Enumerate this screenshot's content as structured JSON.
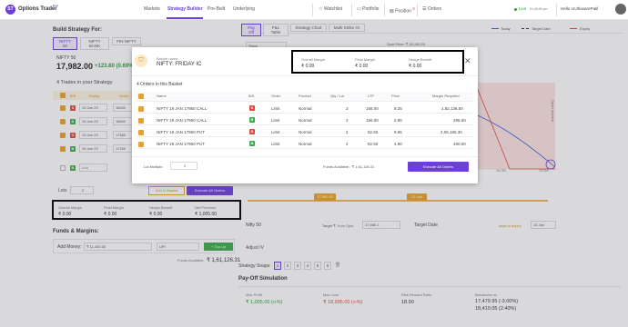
{
  "header": {
    "logo_letter": "ST",
    "brand": "Options Trader",
    "beta": "Beta",
    "nav": [
      "Markets",
      "Strategy Builder",
      "Pre-Built",
      "Underlying"
    ],
    "top_items": [
      "Watchlist",
      "Portfolio",
      "Position",
      "Orders"
    ],
    "position_badge": "8",
    "live_status": "Live",
    "live_time": "01:46:06 pm",
    "greeting": "Hello nnJhavarePatil"
  },
  "left": {
    "title": "Build Strategy For:",
    "instruments": [
      "NIFTY 50",
      "NIFTY BANK",
      "FIN NIFTY"
    ],
    "instrument_name": "NIFTY 50",
    "price": "17,982.00",
    "change": "+123.80 (0.69%)",
    "trades_title": "4 Trades in your Strategy",
    "col_bs": "B/S",
    "col_expiry": "Expiry",
    "col_order": "Order",
    "rows": [
      {
        "bs": "S",
        "expiry": "19 Jan 23",
        "strike": "18400"
      },
      {
        "bs": "B",
        "expiry": "19 Jan 23",
        "strike": "18600"
      },
      {
        "bs": "S",
        "expiry": "19 Jan 23",
        "strike": "17550"
      },
      {
        "bs": "B",
        "expiry": "19 Jan 23",
        "strike": "17250"
      }
    ],
    "add_bs": "B",
    "add_label": "Add",
    "lots_label": "Lots",
    "lots_value": "2",
    "add_to_basket": "Add to Basket",
    "execute_all": "Execute All Orders",
    "summary": [
      {
        "label": "Overall Margin",
        "value": "₹ 0.00"
      },
      {
        "label": "Final Margin",
        "value": "₹ 0.00"
      },
      {
        "label": "Hedge Benefit",
        "value": "₹ 0.00"
      },
      {
        "label": "Net Premium",
        "value": "₹ 1,005.00"
      }
    ],
    "funds_title": "Funds & Margins:",
    "add_money_label": "Add Money:",
    "add_money_value": "₹ 11,400.00",
    "upi": "UPI",
    "top_up": "+ Top Up",
    "funds_available_label": "Funds Available:",
    "funds_available_value": "₹ 1,61,126.31"
  },
  "right": {
    "tabs": [
      "Pay Off",
      "P&L Table",
      "Strategy Chart",
      "Multi Strike OI"
    ],
    "show_label": "Show",
    "spot_price": "Spot Price: ₹ 18,150.20",
    "legend": [
      "Today",
      "Target Date",
      "Expiry"
    ],
    "open_interest": "Open Interest",
    "x_ticks": [
      "18,600",
      "18,750",
      "19,000"
    ],
    "marker_spot": "17,982.00",
    "marker_date": "13 Jan",
    "nifty_label": "Nifty 50",
    "target_label": "Target ₹",
    "from_spot": "from Spot",
    "target_value": "17,980.1",
    "target_date_label": "Target Date",
    "days_to_expiry": "days to expiry",
    "target_date_value": "13 Jan",
    "adjust_iv": "Adjust IV",
    "snaps_label": "Strategy Snaps:",
    "snaps": [
      "1",
      "2",
      "3",
      "4",
      "5",
      "6"
    ],
    "payoff_title": "Pay-Off Simulation",
    "payoff": [
      {
        "label": "Max Profit",
        "value": "₹ 1,005.00 (∞%)"
      },
      {
        "label": "Max Loss",
        "value": "₹ 18,995.00 (∞%)"
      },
      {
        "label": "Risk Reward Ratio",
        "value": "18.90"
      },
      {
        "label": "Breakeven at",
        "value": "17,479.95 (-3.00%)",
        "value2": "18,410.05 (2.40%)"
      }
    ],
    "colors": {
      "today": "#3b5bdb",
      "target": "#1d2a5b",
      "expiry": "#e0473d"
    }
  },
  "modal": {
    "basket_label": "Basket name",
    "basket_name": "NIFTY: FRIDAY IC",
    "header_metrics": [
      {
        "label": "Overall Margin",
        "value": "₹ 0.00"
      },
      {
        "label": "Final Margin",
        "value": "₹ 0.00"
      },
      {
        "label": "Hedge Benefit",
        "value": "₹ 0.00"
      }
    ],
    "orders_count": "4 Orders in this Basket",
    "columns": [
      "Name",
      "B/S",
      "Order",
      "Product",
      "Qty / Lot",
      "LTP",
      "Price",
      "Margin Required"
    ],
    "orders": [
      {
        "name": "NIFTY 19 JAN 17950 CALL",
        "bs": "S",
        "order": "Limit",
        "product": "Normal",
        "qty": "2",
        "ltp": "156.00",
        "price": "8.25",
        "margin": "1,82,136.50"
      },
      {
        "name": "NIFTY 19 JAN 17950 CALL",
        "bs": "B",
        "order": "Limit",
        "product": "Normal",
        "qty": "2",
        "ltp": "156.00",
        "price": "2.95",
        "margin": "295.00"
      },
      {
        "name": "NIFTY 19 JAN 17950 PUT",
        "bs": "S",
        "order": "Limit",
        "product": "Normal",
        "qty": "2",
        "ltp": "82.55",
        "price": "9.65",
        "margin": "2,06,165.30"
      },
      {
        "name": "NIFTY 19 JAN 17950 PUT",
        "bs": "B",
        "order": "Limit",
        "product": "Normal",
        "qty": "2",
        "ltp": "82.55",
        "price": "4.90",
        "margin": "490.00"
      }
    ],
    "lot_multiple_label": "Lot Multiple",
    "lot_multiple_value": "2",
    "funds_available": "Funds Available : ₹ 1,61,126.31",
    "execute_all": "Execute All Orders"
  }
}
